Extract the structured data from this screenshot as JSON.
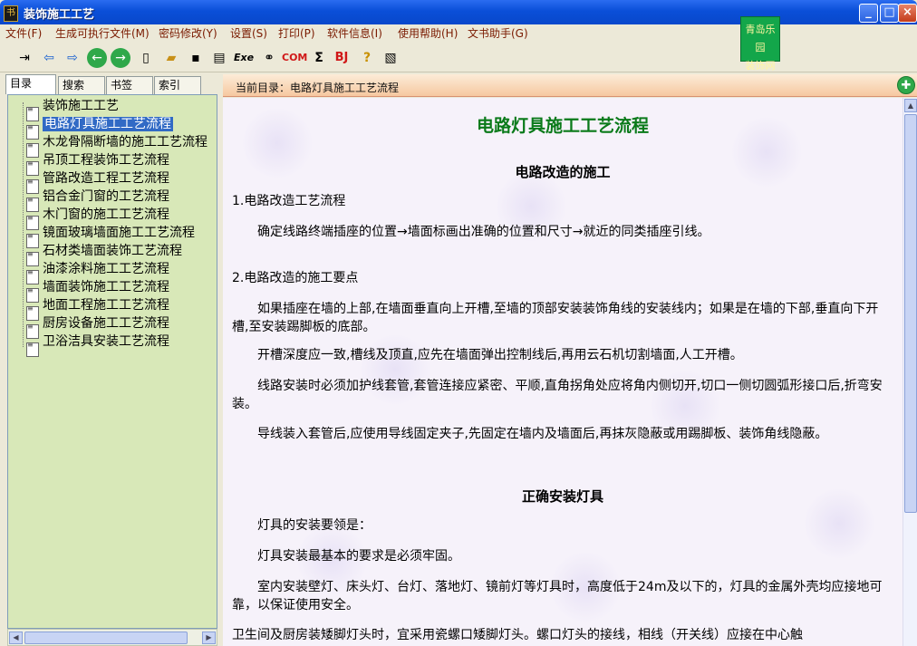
{
  "window": {
    "title": "装饰施工工艺",
    "app_icon": "书"
  },
  "menu": [
    "文件(F)",
    "生成可执行文件(M)",
    "密码修改(Y)",
    "设置(S)",
    "打印(P)",
    "软件信息(I)",
    "使用帮助(H)",
    "文书助手(G)"
  ],
  "ad": {
    "line1": "青岛乐园",
    "line2": "装饰网图书"
  },
  "toolbar": [
    "exit-icon",
    "arrow-left-icon",
    "arrow-right-icon",
    "back-circle-icon",
    "forward-circle-icon",
    "new-page-icon",
    "open-folder-icon",
    "save-icon",
    "print-icon",
    "exe-icon",
    "binoculars-icon",
    "com-icon",
    "sigma-icon",
    "bj-icon",
    "help-icon",
    "clipboard-icon"
  ],
  "toolbar_text": {
    "exe": "Exe",
    "com": "COM",
    "sigma": "Σ",
    "bj": "BJ",
    "help": "?"
  },
  "tabs": [
    "目录",
    "搜索",
    "书签",
    "索引"
  ],
  "tree": [
    "装饰施工工艺",
    "电路灯具施工工艺流程",
    "木龙骨隔断墙的施工工艺流程",
    "吊顶工程装饰工艺流程",
    "管路改造工程工艺流程",
    "铝合金门窗的工艺流程",
    "木门窗的施工工艺流程",
    "镜面玻璃墙面施工工艺流程",
    "石材类墙面装饰工艺流程",
    "油漆涂料施工工艺流程",
    "墙面装饰施工工艺流程",
    "地面工程施工工艺流程",
    "厨房设备施工工艺流程",
    "卫浴洁具安装工艺流程"
  ],
  "selected_index": 1,
  "current_dir": "当前目录：电路灯具施工工艺流程",
  "doc": {
    "title": "电路灯具施工工艺流程",
    "section1": "电路改造的施工",
    "s1_h1": "1.电路改造工艺流程",
    "s1_p1": "确定线路终端插座的位置→墙面标画出准确的位置和尺寸→就近的同类插座引线。",
    "s1_h2": "2.电路改造的施工要点",
    "s1_p2": "如果插座在墙的上部,在墙面垂直向上开槽,至墙的顶部安装装饰角线的安装线内；如果是在墙的下部,垂直向下开槽,至安装踢脚板的底部。",
    "s1_p3": "开槽深度应一致,槽线及顶直,应先在墙面弹出控制线后,再用云石机切割墙面,人工开槽。",
    "s1_p4": "线路安装时必须加护线套管,套管连接应紧密、平顺,直角拐角处应将角内侧切开,切口一侧切圆弧形接口后,折弯安装。",
    "s1_p5": "导线装入套管后,应使用导线固定夹子,先固定在墙内及墙面后,再抹灰隐蔽或用踢脚板、装饰角线隐蔽。",
    "section2": "正确安装灯具",
    "s2_p1": "灯具的安装要领是：",
    "s2_p2": "灯具安装最基本的要求是必须牢固。",
    "s2_p3": "室内安装壁灯、床头灯、台灯、落地灯、镜前灯等灯具时，高度低于24m及以下的，灯具的金属外壳均应接地可靠，以保证使用安全。",
    "s2_p4": "卫生间及厨房装矮脚灯头时，宜采用瓷螺口矮脚灯头。螺口灯头的接线，相线（开关线）应接在中心触"
  }
}
